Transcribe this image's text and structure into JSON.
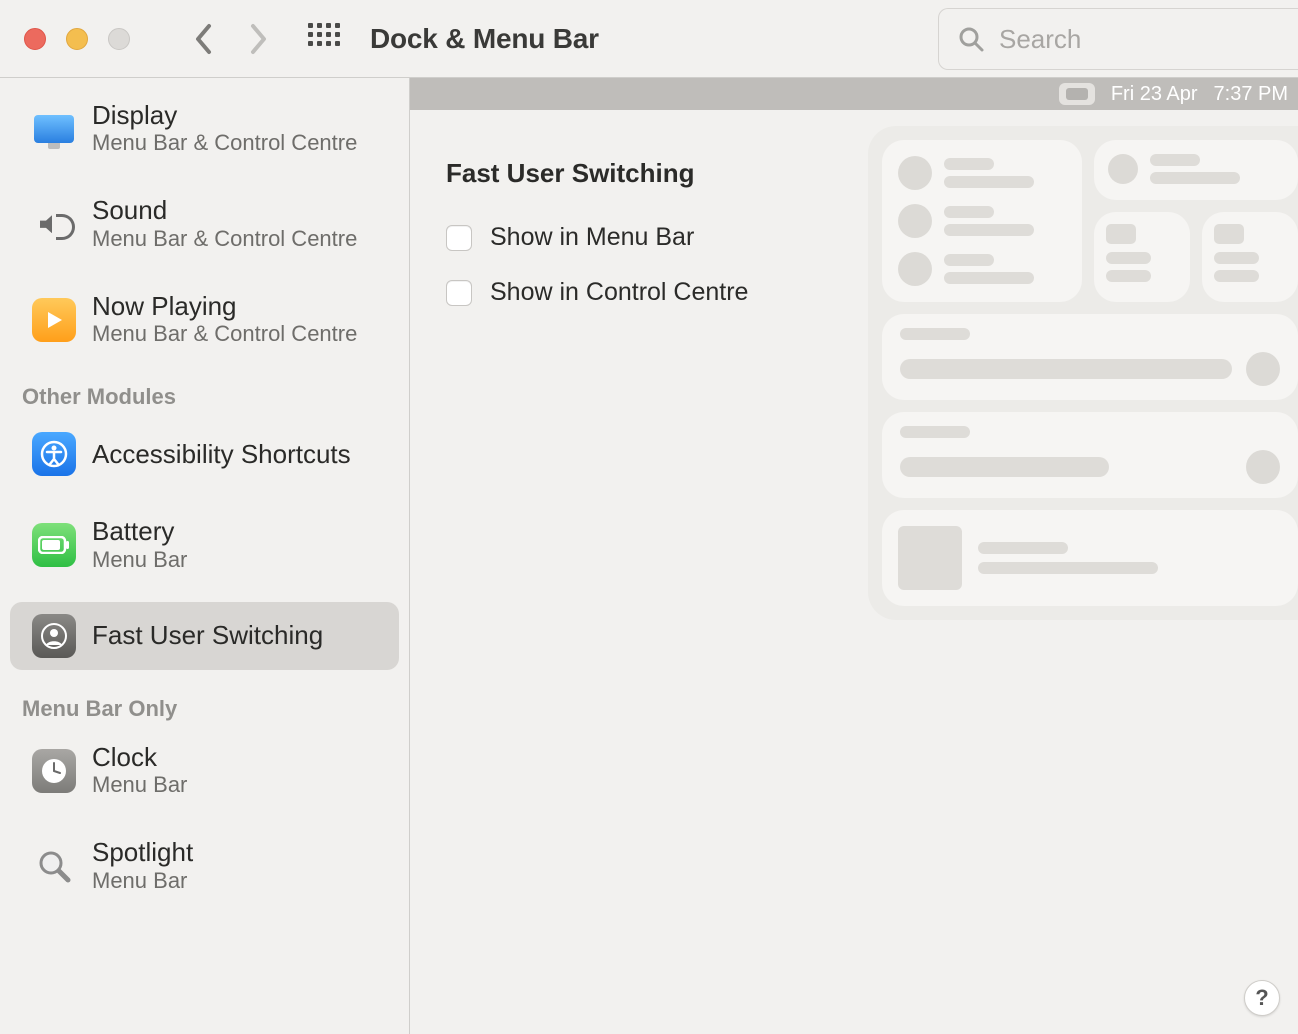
{
  "window": {
    "title": "Dock & Menu Bar"
  },
  "search": {
    "placeholder": "Search"
  },
  "sidebar": {
    "items_top": [
      {
        "title": "Display",
        "subtitle": "Menu Bar & Control Centre",
        "icon": "display-icon"
      },
      {
        "title": "Sound",
        "subtitle": "Menu Bar & Control Centre",
        "icon": "sound-icon"
      },
      {
        "title": "Now Playing",
        "subtitle": "Menu Bar & Control Centre",
        "icon": "now-playing-icon"
      }
    ],
    "section_other_header": "Other Modules",
    "items_other": [
      {
        "title": "Accessibility Shortcuts",
        "subtitle": "",
        "icon": "accessibility-icon"
      },
      {
        "title": "Battery",
        "subtitle": "Menu Bar",
        "icon": "battery-icon"
      },
      {
        "title": "Fast User Switching",
        "subtitle": "",
        "icon": "fast-user-switching-icon",
        "selected": true
      }
    ],
    "section_menubar_header": "Menu Bar Only",
    "items_menubar": [
      {
        "title": "Clock",
        "subtitle": "Menu Bar",
        "icon": "clock-icon"
      },
      {
        "title": "Spotlight",
        "subtitle": "Menu Bar",
        "icon": "spotlight-icon"
      }
    ]
  },
  "menubar_preview": {
    "date": "Fri 23 Apr",
    "time": "7:37 PM"
  },
  "detail": {
    "heading": "Fast User Switching",
    "option_menu_bar": "Show in Menu Bar",
    "option_control_centre": "Show in Control Centre"
  },
  "help_label": "?"
}
